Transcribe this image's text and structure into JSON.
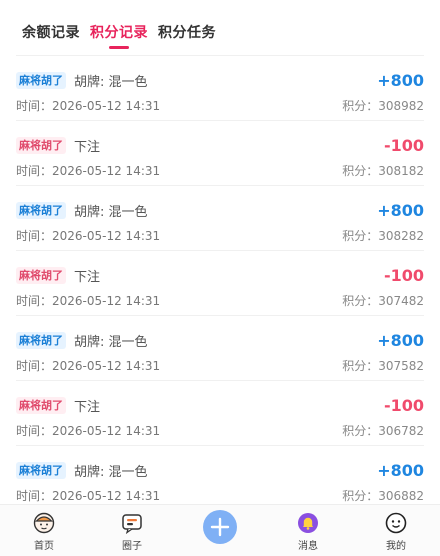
{
  "tabs": [
    {
      "label": "余额记录",
      "active": false
    },
    {
      "label": "积分记录",
      "active": true
    },
    {
      "label": "积分任务",
      "active": false
    }
  ],
  "records": [
    {
      "tag": "麻将胡了",
      "type": "win",
      "desc": "胡牌: 混一色",
      "time": "时间：2026-05-12 14:31",
      "amount": "+800",
      "balance": "积分：308982"
    },
    {
      "tag": "麻将胡了",
      "type": "lose",
      "desc": "下注",
      "time": "时间：2026-05-12 14:31",
      "amount": "-100",
      "balance": "积分：308182"
    },
    {
      "tag": "麻将胡了",
      "type": "win",
      "desc": "胡牌: 混一色",
      "time": "时间：2026-05-12 14:31",
      "amount": "+800",
      "balance": "积分：308282"
    },
    {
      "tag": "麻将胡了",
      "type": "lose",
      "desc": "下注",
      "time": "时间：2026-05-12 14:31",
      "amount": "-100",
      "balance": "积分：307482"
    },
    {
      "tag": "麻将胡了",
      "type": "win",
      "desc": "胡牌: 混一色",
      "time": "时间：2026-05-12 14:31",
      "amount": "+800",
      "balance": "积分：307582"
    },
    {
      "tag": "麻将胡了",
      "type": "lose",
      "desc": "下注",
      "time": "时间：2026-05-12 14:31",
      "amount": "-100",
      "balance": "积分：306782"
    },
    {
      "tag": "麻将胡了",
      "type": "win",
      "desc": "胡牌: 混一色",
      "time": "时间：2026-05-12 14:31",
      "amount": "+800",
      "balance": "积分：306882"
    }
  ],
  "nav": {
    "home": {
      "label": "首页",
      "icon": "home-avatar-icon"
    },
    "circle": {
      "label": "圈子",
      "icon": "chat-box-icon"
    },
    "publish": {
      "icon": "plus-icon"
    },
    "messages": {
      "label": "消息",
      "icon": "bell-icon"
    },
    "mine": {
      "label": "我的",
      "icon": "smile-face-icon"
    }
  },
  "colors": {
    "accent": "#e8245c",
    "win": "#1f86e0",
    "lose": "#f04b6c",
    "publish_button": "#7fb0f5"
  }
}
